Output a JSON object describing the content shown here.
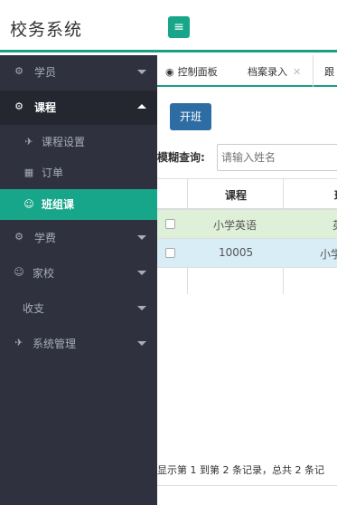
{
  "app": {
    "title": "校务系统",
    "menu_toggle_icon": "hamburger-icon"
  },
  "sidebar": {
    "items": [
      {
        "label": "学员",
        "icon": "gears-icon",
        "expanded": false
      },
      {
        "label": "课程",
        "icon": "gears-icon",
        "expanded": true
      },
      {
        "label": "课程设置",
        "icon": "send-icon",
        "sub": true
      },
      {
        "label": "订单",
        "icon": "calendar-icon",
        "sub": true
      },
      {
        "label": "班组课",
        "icon": "smile-icon",
        "sub": true,
        "selected": true
      },
      {
        "label": "学费",
        "icon": "gears-icon",
        "expanded": false
      },
      {
        "label": "家校",
        "icon": "smile-icon",
        "expanded": false
      },
      {
        "label": "收支",
        "icon": "",
        "expanded": false
      },
      {
        "label": "系统管理",
        "icon": "send-icon",
        "expanded": false
      }
    ]
  },
  "tabs": {
    "items": [
      {
        "label": "控制面板",
        "icon": "dashboard-icon"
      },
      {
        "label": "档案录入",
        "closable": true
      },
      {
        "label": "跟"
      }
    ]
  },
  "toolbar": {
    "open_class_label": "开班"
  },
  "search": {
    "label": "模糊查询:",
    "placeholder": "请输入姓名"
  },
  "table": {
    "headers": [
      "课程",
      "班"
    ],
    "rows": [
      {
        "course": "小学英语",
        "class": "英"
      },
      {
        "course": "10005",
        "class": "小学"
      }
    ]
  },
  "pagination": {
    "info": "显示第 1 到第 2 条记录，总共 2 条记"
  },
  "colors": {
    "accent": "#17a689",
    "sidebar_bg": "#2f323e",
    "primary_button": "#2e6da4",
    "row_success": "#dff0d8",
    "row_info": "#d9edf7"
  }
}
